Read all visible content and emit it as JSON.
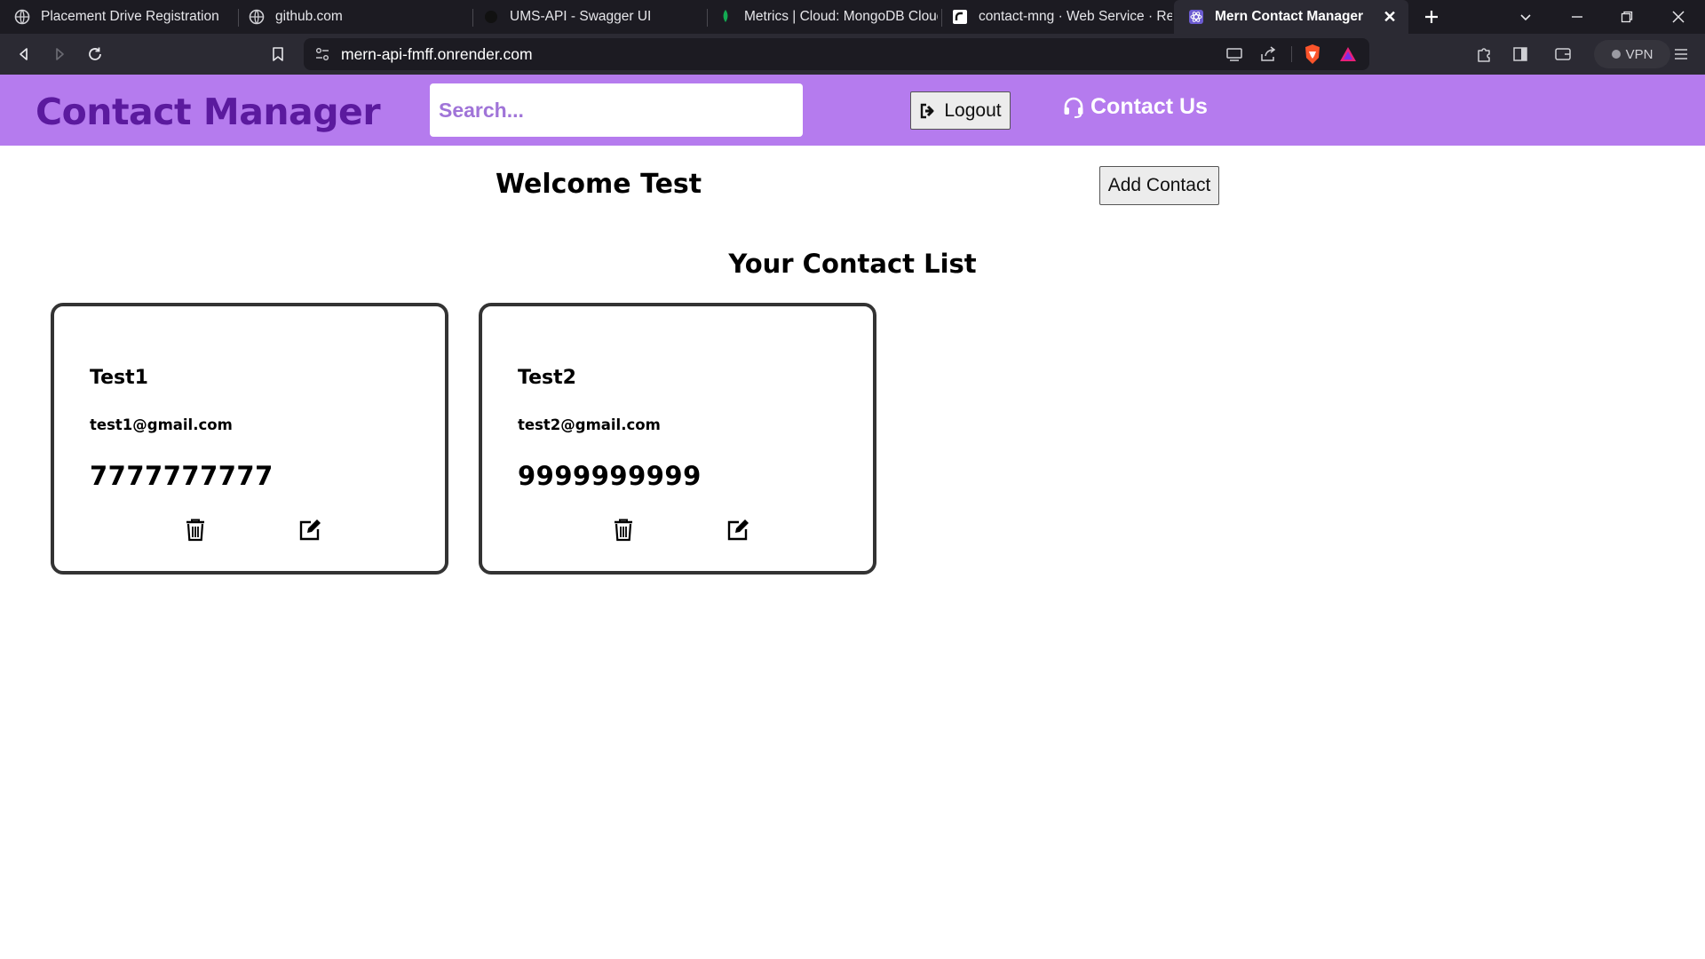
{
  "browser": {
    "tabs": [
      {
        "title": "Placement Drive Registration",
        "icon": "globe-icon",
        "active": false
      },
      {
        "title": "github.com",
        "icon": "globe-icon",
        "active": false
      },
      {
        "title": "UMS-API - Swagger UI",
        "icon": "swagger-icon",
        "active": false
      },
      {
        "title": "Metrics | Cloud: MongoDB Cloud",
        "icon": "mongodb-leaf-icon",
        "active": false
      },
      {
        "title": "contact-mng · Web Service · Render",
        "icon": "render-icon",
        "active": false
      },
      {
        "title": "Mern Contact Manager",
        "icon": "react-icon",
        "active": true
      }
    ],
    "url": "mern-api-fmff.onrender.com",
    "vpn_label": "VPN"
  },
  "navbar": {
    "brand": "Contact Manager",
    "search_placeholder": "Search...",
    "logout_label": "Logout",
    "contact_us_label": "Contact Us",
    "background": "#b57bee",
    "brand_color": "#5b1a9e"
  },
  "main": {
    "welcome": "Welcome Test",
    "add_contact_label": "Add Contact",
    "list_title": "Your Contact List"
  },
  "contacts": [
    {
      "name": "Test1",
      "email": "test1@gmail.com",
      "phone": "7777777777"
    },
    {
      "name": "Test2",
      "email": "test2@gmail.com",
      "phone": "9999999999"
    }
  ]
}
